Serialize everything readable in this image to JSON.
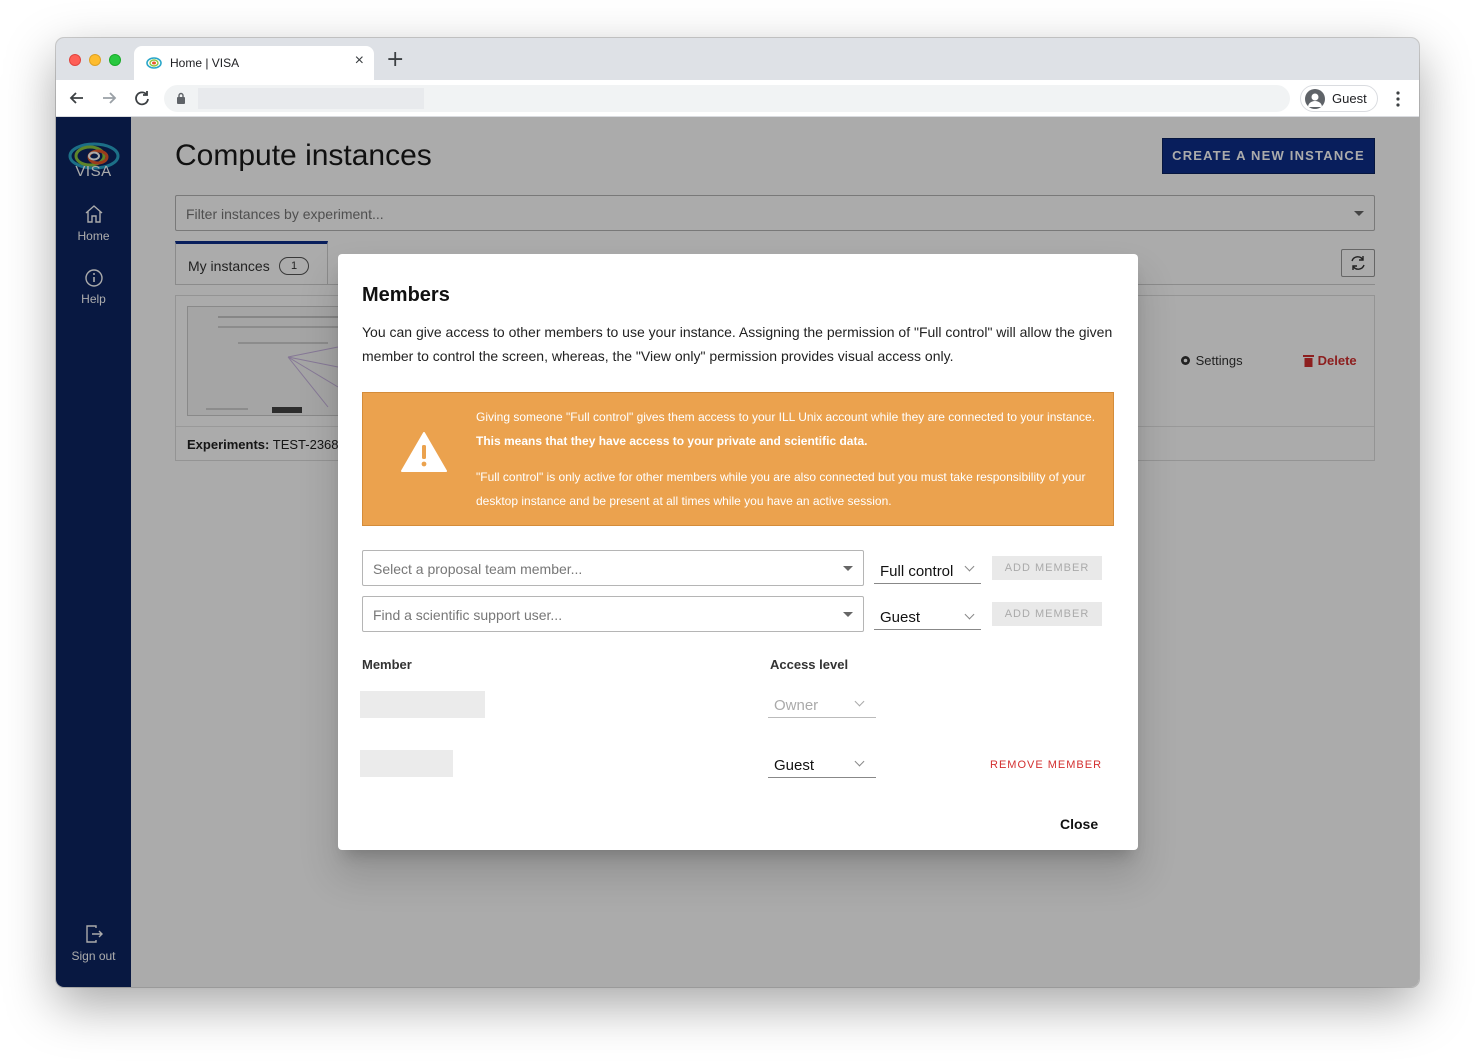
{
  "browser": {
    "tab_title": "Home | VISA",
    "tab_close": "×",
    "new_tab": "+",
    "profile_label": "Guest"
  },
  "sidebar": {
    "logo_text": "VISA",
    "items": [
      {
        "label": "Home",
        "icon": "home-icon"
      },
      {
        "label": "Help",
        "icon": "info-icon"
      }
    ],
    "sign_out": {
      "label": "Sign out",
      "icon": "sign-out-icon"
    }
  },
  "main": {
    "title": "Compute instances",
    "create_button": "CREATE A NEW INSTANCE",
    "filter_placeholder": "Filter instances by experiment...",
    "tab_label": "My instances",
    "tab_count": "1",
    "card": {
      "experiments_label": "Experiments:",
      "experiments_value": "TEST-2368 (",
      "settings": "Settings",
      "delete": "Delete"
    }
  },
  "dialog": {
    "title": "Members",
    "description": "You can give access to other members to use your instance. Assigning the permission of \"Full control\" will allow the given member to control the screen, whereas, the \"View only\" permission provides visual access only.",
    "warning": {
      "line1": "Giving someone \"Full control\" gives them access to your ILL Unix account while they are connected to your instance. ",
      "line1_bold": "This means that they have access to your private and scientific data.",
      "line2": "\"Full control\" is only active for other members while you are also connected but you must take responsibility of your desktop instance and be present at all times while you have an active session."
    },
    "add_rows": [
      {
        "placeholder": "Select a proposal team member...",
        "permission": "Full control",
        "button": "ADD MEMBER"
      },
      {
        "placeholder": "Find a scientific support user...",
        "permission": "Guest",
        "button": "ADD MEMBER"
      }
    ],
    "columns": {
      "member": "Member",
      "access": "Access level"
    },
    "members": [
      {
        "access": "Owner"
      },
      {
        "access": "Guest",
        "action": "REMOVE MEMBER"
      }
    ],
    "close": "Close"
  },
  "colors": {
    "sidebar": "#0c2462",
    "primary": "#0c2e8a",
    "warning": "#eba24e",
    "danger": "#d32f2f"
  }
}
